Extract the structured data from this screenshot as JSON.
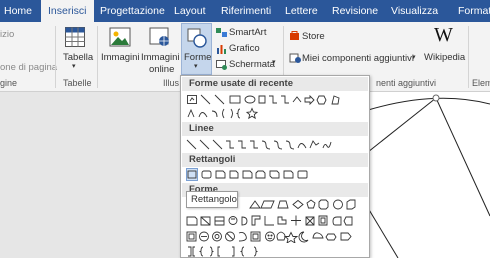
{
  "tabs": {
    "home": "Home",
    "insert": "Inserisci",
    "design": "Progettazione",
    "layout": "Layout",
    "references": "Riferimenti",
    "mailings": "Lettere",
    "review": "Revisione",
    "view": "Visualizza",
    "format": "Format"
  },
  "ribbon": {
    "cover_page_partial": "izio",
    "page_break_partial": "one di pagina",
    "pages_group_partial": "gine",
    "table_button": "Tabella",
    "tables_group": "Tabelle",
    "pictures_button": "Immagini",
    "online_pictures_line1": "Immagini",
    "online_pictures_line2": "online",
    "shapes_button": "Forme",
    "illustrations_group_partial": "Illus",
    "smartart_button": "SmartArt",
    "chart_button": "Grafico",
    "screenshot_button": "Schermata",
    "store_button": "Store",
    "my_addins_button": "Miei componenti aggiuntivi",
    "wikipedia_button": "Wikipedia",
    "addins_group_partial": "nenti aggiuntivi",
    "media_group_partial": "Elem"
  },
  "shapes_menu": {
    "recent_header": "Forme usate di recente",
    "lines_header": "Linee",
    "rectangles_header": "Rettangoli",
    "basic_header_partial": "Forme",
    "tooltip": "Rettangolo"
  },
  "colors": {
    "tab_bar": "#2b579a",
    "ribbon": "#f3f3f3",
    "accent_blue": "#2b579a",
    "store_red": "#d83b01"
  }
}
